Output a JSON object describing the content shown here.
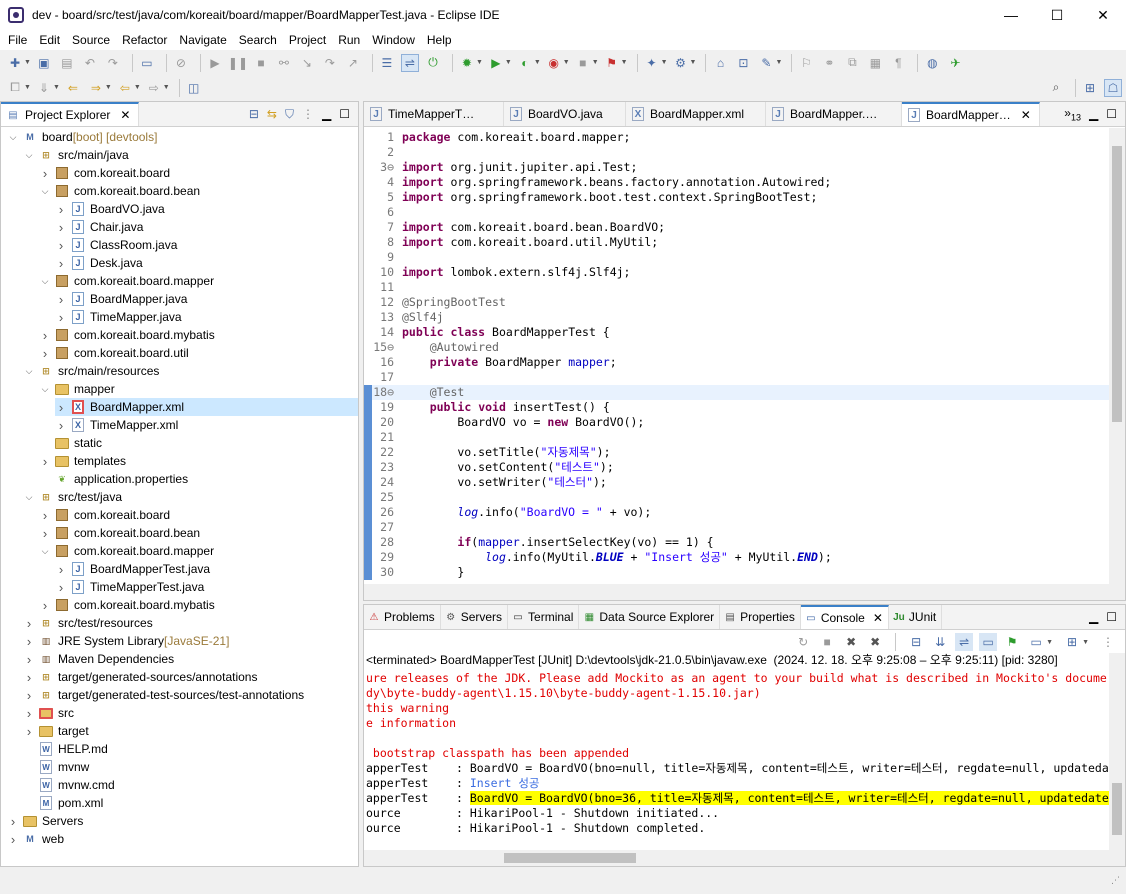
{
  "window": {
    "title": "dev - board/src/test/java/com/koreait/board/mapper/BoardMapperTest.java - Eclipse IDE",
    "minimize": "—",
    "maximize": "☐",
    "close": "✕"
  },
  "menu": [
    "File",
    "Edit",
    "Source",
    "Refactor",
    "Navigate",
    "Search",
    "Project",
    "Run",
    "Window",
    "Help"
  ],
  "explorer": {
    "tab_label": "Project Explorer",
    "close": "✕",
    "items": [
      {
        "label": "board",
        "decoration": " [boot] [devtools]",
        "icon": "project-icon",
        "expanded": true
      },
      {
        "label": "src/main/java",
        "decoration": "",
        "icon": "source-folder-icon",
        "expanded": true
      },
      {
        "label": "com.koreait.board",
        "decoration": "",
        "icon": "package-icon",
        "expanded": false
      },
      {
        "label": "com.koreait.board.bean",
        "decoration": "",
        "icon": "package-icon",
        "expanded": true
      },
      {
        "label": "BoardVO.java",
        "decoration": "",
        "icon": "java-file-icon",
        "expanded": false
      },
      {
        "label": "Chair.java",
        "decoration": "",
        "icon": "java-file-icon",
        "expanded": false
      },
      {
        "label": "ClassRoom.java",
        "decoration": "",
        "icon": "java-file-icon",
        "expanded": false
      },
      {
        "label": "Desk.java",
        "decoration": "",
        "icon": "java-file-icon",
        "expanded": false
      },
      {
        "label": "com.koreait.board.mapper",
        "decoration": "",
        "icon": "package-icon",
        "expanded": true
      },
      {
        "label": "BoardMapper.java",
        "decoration": "",
        "icon": "java-interface-icon",
        "expanded": false
      },
      {
        "label": "TimeMapper.java",
        "decoration": "",
        "icon": "java-interface-icon",
        "expanded": false
      },
      {
        "label": "com.koreait.board.mybatis",
        "decoration": "",
        "icon": "package-icon",
        "expanded": false
      },
      {
        "label": "com.koreait.board.util",
        "decoration": "",
        "icon": "package-icon",
        "expanded": false
      },
      {
        "label": "src/main/resources",
        "decoration": "",
        "icon": "source-folder-icon",
        "expanded": true
      },
      {
        "label": "mapper",
        "decoration": "",
        "icon": "folder-icon",
        "expanded": true
      },
      {
        "label": "BoardMapper.xml",
        "decoration": "",
        "icon": "xml-error-icon",
        "expanded": false,
        "selected": true
      },
      {
        "label": "TimeMapper.xml",
        "decoration": "",
        "icon": "xml-file-icon",
        "expanded": false
      },
      {
        "label": "static",
        "decoration": "",
        "icon": "folder-icon",
        "expanded": null
      },
      {
        "label": "templates",
        "decoration": "",
        "icon": "folder-icon",
        "expanded": false
      },
      {
        "label": "application.properties",
        "decoration": "",
        "icon": "properties-leaf-icon",
        "expanded": null
      },
      {
        "label": "src/test/java",
        "decoration": "",
        "icon": "source-folder-icon",
        "expanded": true
      },
      {
        "label": "com.koreait.board",
        "decoration": "",
        "icon": "package-icon",
        "expanded": false
      },
      {
        "label": "com.koreait.board.bean",
        "decoration": "",
        "icon": "package-icon",
        "expanded": false
      },
      {
        "label": "com.koreait.board.mapper",
        "decoration": "",
        "icon": "package-icon",
        "expanded": true
      },
      {
        "label": "BoardMapperTest.java",
        "decoration": "",
        "icon": "java-file-icon",
        "expanded": false
      },
      {
        "label": "TimeMapperTest.java",
        "decoration": "",
        "icon": "java-file-icon",
        "expanded": false
      },
      {
        "label": "com.koreait.board.mybatis",
        "decoration": "",
        "icon": "package-icon",
        "expanded": false
      },
      {
        "label": "src/test/resources",
        "decoration": "",
        "icon": "source-folder-icon",
        "expanded": false
      },
      {
        "label": "JRE System Library",
        "decoration": " [JavaSE-21]",
        "icon": "library-icon",
        "expanded": false
      },
      {
        "label": "Maven Dependencies",
        "decoration": "",
        "icon": "library-icon",
        "expanded": false
      },
      {
        "label": "target/generated-sources/annotations",
        "decoration": "",
        "icon": "source-folder-icon",
        "expanded": false
      },
      {
        "label": "target/generated-test-sources/test-annotations",
        "decoration": "",
        "icon": "source-folder-icon",
        "expanded": false
      },
      {
        "label": "src",
        "decoration": "",
        "icon": "folder-error-icon",
        "expanded": false
      },
      {
        "label": "target",
        "decoration": "",
        "icon": "folder-icon",
        "expanded": false
      },
      {
        "label": "HELP.md",
        "decoration": "",
        "icon": "text-file-icon",
        "expanded": null
      },
      {
        "label": "mvnw",
        "decoration": "",
        "icon": "text-file-icon",
        "expanded": null
      },
      {
        "label": "mvnw.cmd",
        "decoration": "",
        "icon": "text-file-icon",
        "expanded": null
      },
      {
        "label": "pom.xml",
        "decoration": "",
        "icon": "maven-pom-icon",
        "expanded": null
      },
      {
        "label": "Servers",
        "decoration": "",
        "icon": "folder-icon",
        "expanded": false
      },
      {
        "label": "web",
        "decoration": "",
        "icon": "project-icon",
        "expanded": false
      }
    ]
  },
  "editor_tabs": [
    {
      "label": "TimeMapperT…",
      "icon": "J"
    },
    {
      "label": "BoardVO.java",
      "icon": "J"
    },
    {
      "label": "BoardMapper.xml",
      "icon": "X"
    },
    {
      "label": "BoardMapper.…",
      "icon": "J"
    },
    {
      "label": "BoardMapper…",
      "icon": "J",
      "active": true
    }
  ],
  "editor_overflow": "»",
  "editor_overflow_count": "13",
  "code": [
    {
      "n": "1",
      "t": "package com.koreait.board.mapper;"
    },
    {
      "n": "2",
      "t": ""
    },
    {
      "n": "3⊖",
      "t": "import org.junit.jupiter.api.Test;"
    },
    {
      "n": "4",
      "t": "import org.springframework.beans.factory.annotation.Autowired;"
    },
    {
      "n": "5",
      "t": "import org.springframework.boot.test.context.SpringBootTest;"
    },
    {
      "n": "6",
      "t": ""
    },
    {
      "n": "7",
      "t": "import com.koreait.board.bean.BoardVO;"
    },
    {
      "n": "8",
      "t": "import com.koreait.board.util.MyUtil;"
    },
    {
      "n": "9",
      "t": ""
    },
    {
      "n": "10",
      "t": "import lombok.extern.slf4j.Slf4j;"
    },
    {
      "n": "11",
      "t": ""
    },
    {
      "n": "12",
      "t": "@SpringBootTest"
    },
    {
      "n": "13",
      "t": "@Slf4j"
    },
    {
      "n": "14",
      "t": "public class BoardMapperTest {"
    },
    {
      "n": "15⊖",
      "t": "    @Autowired"
    },
    {
      "n": "16",
      "t": "    private BoardMapper mapper;"
    },
    {
      "n": "17",
      "t": ""
    },
    {
      "n": "18⊖",
      "t": "    @Test"
    },
    {
      "n": "19",
      "t": "    public void insertTest() {"
    },
    {
      "n": "20",
      "t": "        BoardVO vo = new BoardVO();"
    },
    {
      "n": "21",
      "t": ""
    },
    {
      "n": "22",
      "t": "        vo.setTitle(\"자동제목\");"
    },
    {
      "n": "23",
      "t": "        vo.setContent(\"테스트\");"
    },
    {
      "n": "24",
      "t": "        vo.setWriter(\"테스터\");"
    },
    {
      "n": "25",
      "t": ""
    },
    {
      "n": "26",
      "t": "        log.info(\"BoardVO = \" + vo);"
    },
    {
      "n": "27",
      "t": ""
    },
    {
      "n": "28",
      "t": "        if(mapper.insertSelectKey(vo) == 1) {"
    },
    {
      "n": "29",
      "t": "            log.info(MyUtil.BLUE + \"Insert 성공\" + MyUtil.END);"
    },
    {
      "n": "30",
      "t": "        }"
    }
  ],
  "bottom_tabs": [
    {
      "label": "Problems",
      "icon": "problems-icon"
    },
    {
      "label": "Servers",
      "icon": "servers-icon"
    },
    {
      "label": "Terminal",
      "icon": "terminal-icon"
    },
    {
      "label": "Data Source Explorer",
      "icon": "data-source-icon"
    },
    {
      "label": "Properties",
      "icon": "properties-icon"
    },
    {
      "label": "Console",
      "icon": "console-icon",
      "active": true
    },
    {
      "label": "JUnit",
      "icon": "junit-icon"
    }
  ],
  "console": {
    "header": "<terminated> BoardMapperTest [JUnit] D:\\devtools\\jdk-21.0.5\\bin\\javaw.exe  (2024. 12. 18. 오후 9:25:08 – 오후 9:25:11) [pid: 3280]",
    "lines": [
      {
        "t": "ure releases of the JDK. Please add Mockito as an agent to your build what is described in Mockito's docume",
        "c": "err"
      },
      {
        "t": "dy\\byte-buddy-agent\\1.15.10\\byte-buddy-agent-1.15.10.jar)",
        "c": "err"
      },
      {
        "t": "this warning",
        "c": "err"
      },
      {
        "t": "e information",
        "c": "err"
      },
      {
        "t": "",
        "c": ""
      },
      {
        "t": " bootstrap classpath has been appended",
        "c": "err"
      },
      {
        "t": "apperTest    : BoardVO = BoardVO(bno=null, title=자동제목, content=테스트, writer=테스터, regdate=null, updatedat",
        "c": ""
      },
      {
        "t": "apperTest    : ",
        "c": "",
        "tail": "Insert 성공",
        "tailc": "blue"
      },
      {
        "t": "apperTest    : ",
        "c": "",
        "tail": "BoardVO = BoardVO(bno=36, title=자동제목, content=테스트, writer=테스터, regdate=null, updatedate=",
        "tailc": "hl"
      },
      {
        "t": "ource        : HikariPool-1 - Shutdown initiated...",
        "c": ""
      },
      {
        "t": "ource        : HikariPool-1 - Shutdown completed.",
        "c": ""
      }
    ]
  }
}
